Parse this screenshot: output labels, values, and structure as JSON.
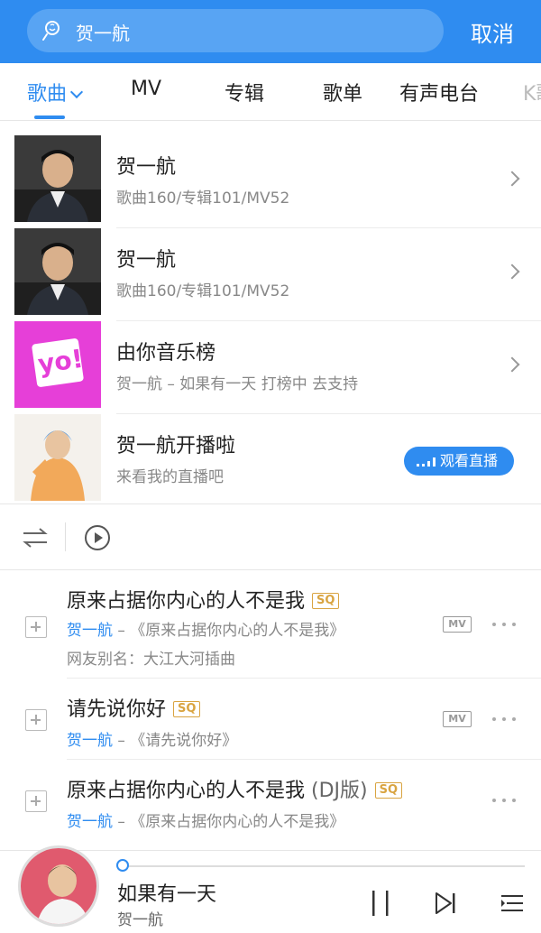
{
  "search": {
    "query": "贺一航",
    "cancel_label": "取消"
  },
  "tabs": [
    {
      "label": "歌曲"
    },
    {
      "label": "MV"
    },
    {
      "label": "专辑"
    },
    {
      "label": "歌单"
    },
    {
      "label": "有声电台"
    },
    {
      "label": "K歌"
    }
  ],
  "results": [
    {
      "title": "贺一航",
      "subtitle": "歌曲160/专辑101/MV52"
    },
    {
      "title": "贺一航",
      "subtitle": "歌曲160/专辑101/MV52"
    },
    {
      "title": "由你音乐榜",
      "subtitle": "贺一航 – 如果有一天 打榜中 去支持",
      "logo_text": "yo!"
    },
    {
      "title": "贺一航开播啦",
      "subtitle": "来看我的直播吧",
      "action_label": "观看直播"
    }
  ],
  "songs": [
    {
      "title": "原来占据你内心的人不是我",
      "title_suffix": "",
      "quality": "SQ",
      "artist": "贺一航",
      "album": " – 《原来占据你内心的人不是我》",
      "alias": "网友别名：大江大河插曲",
      "mv": "MV"
    },
    {
      "title": "请先说你好",
      "title_suffix": "",
      "quality": "SQ",
      "artist": "贺一航",
      "album": " – 《请先说你好》",
      "mv": "MV"
    },
    {
      "title": "原来占据你内心的人不是我",
      "title_suffix": " (DJ版)",
      "quality": "SQ",
      "artist": "贺一航",
      "album": " – 《原来占据你内心的人不是我》"
    }
  ],
  "player": {
    "title": "如果有一天",
    "artist": "贺一航",
    "progress": 0.0
  },
  "colors": {
    "accent": "#2f8cf0",
    "sq_gold": "#d9a441",
    "yo_pink": "#e63fd8"
  }
}
